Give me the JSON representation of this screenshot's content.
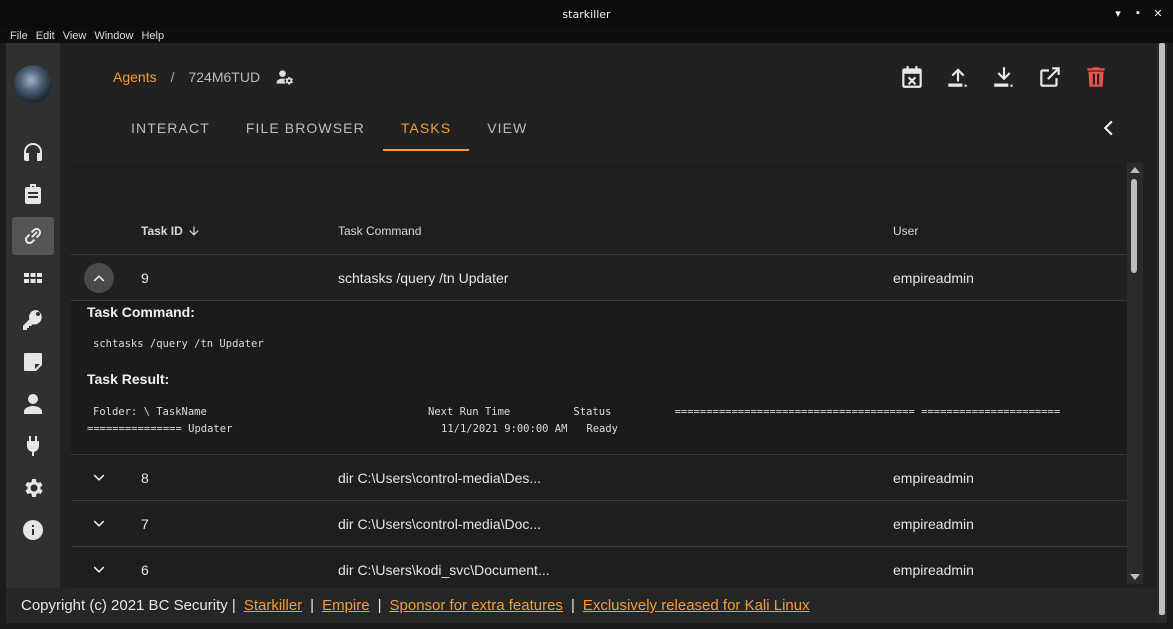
{
  "window": {
    "title": "starkiller",
    "minimize": "▾",
    "maximize": "▪",
    "close": "✕"
  },
  "menu": [
    "File",
    "Edit",
    "View",
    "Window",
    "Help"
  ],
  "sidebar": {
    "items": [
      {
        "name": "listeners",
        "icon": "headphones-icon"
      },
      {
        "name": "stagers",
        "icon": "briefcase-icon"
      },
      {
        "name": "agents",
        "icon": "link-icon",
        "active": true
      },
      {
        "name": "modules",
        "icon": "grid-icon"
      },
      {
        "name": "credentials",
        "icon": "key-icon"
      },
      {
        "name": "reporting",
        "icon": "note-icon"
      },
      {
        "name": "users",
        "icon": "person-icon"
      },
      {
        "name": "plugins",
        "icon": "plug-icon"
      },
      {
        "name": "settings",
        "icon": "gear-icon"
      },
      {
        "name": "about",
        "icon": "info-icon"
      }
    ]
  },
  "breadcrumb": {
    "root": "Agents",
    "separator": "/",
    "current": "724M6TUD"
  },
  "tabs": [
    "INTERACT",
    "FILE BROWSER",
    "TASKS",
    "VIEW"
  ],
  "active_tab": "TASKS",
  "table": {
    "headers": {
      "task_id": "Task ID",
      "command": "Task Command",
      "user": "User"
    },
    "rows": [
      {
        "id": "9",
        "command": "schtasks /query /tn Updater",
        "user": "empireadmin",
        "expanded": true
      },
      {
        "id": "8",
        "command": "dir C:\\Users\\control-media\\Des...",
        "user": "empireadmin"
      },
      {
        "id": "7",
        "command": "dir C:\\Users\\control-media\\Doc...",
        "user": "empireadmin"
      },
      {
        "id": "6",
        "command": "dir C:\\Users\\kodi_svc\\Document...",
        "user": "empireadmin"
      }
    ],
    "detail": {
      "command_label": "Task Command:",
      "command_text": "schtasks /query /tn Updater",
      "result_label": "Task Result:",
      "result_line1": "Folder: \\ TaskName                                   Next Run Time          Status          ====================================== ======================",
      "result_line2": "=============== Updater                                 11/1/2021 9:00:00 AM   Ready"
    }
  },
  "footer": {
    "prefix": "Copyright (c) 2021 BC Security |",
    "links": [
      "Starkiller",
      "Empire",
      "Sponsor for extra features",
      "Exclusively released for Kali Linux"
    ],
    "separator": "|"
  },
  "colors": {
    "accent": "#f39c3a",
    "danger": "#ef5350",
    "background": "#212121"
  }
}
